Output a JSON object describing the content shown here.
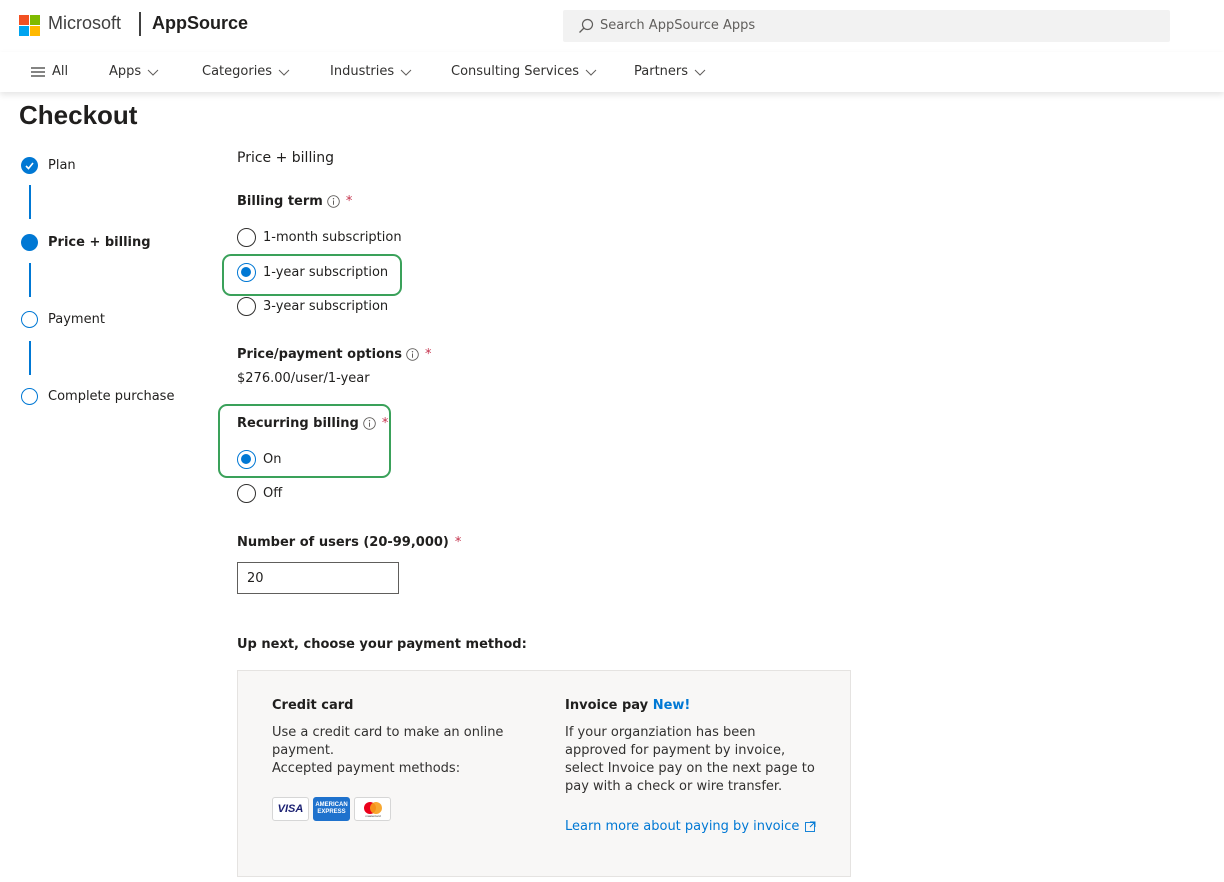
{
  "header": {
    "brand": "Microsoft",
    "app": "AppSource",
    "search_placeholder": "Search AppSource Apps",
    "logo_colors": [
      "#f25022",
      "#7fba00",
      "#00a4ef",
      "#ffb900"
    ]
  },
  "nav": {
    "all_label": "All",
    "items": [
      {
        "label": "Apps"
      },
      {
        "label": "Categories"
      },
      {
        "label": "Industries"
      },
      {
        "label": "Consulting Services"
      },
      {
        "label": "Partners"
      }
    ]
  },
  "page": {
    "title": "Checkout"
  },
  "steps": [
    {
      "label": "Plan",
      "state": "done"
    },
    {
      "label": "Price + billing",
      "state": "current"
    },
    {
      "label": "Payment",
      "state": "pending"
    },
    {
      "label": "Complete purchase",
      "state": "pending"
    }
  ],
  "form": {
    "section_title": "Price + billing",
    "billing_term": {
      "label": "Billing term",
      "required_mark": "*",
      "options": [
        "1-month subscription",
        "1-year subscription",
        "3-year subscription"
      ],
      "selected": "1-year subscription"
    },
    "price_options": {
      "label": "Price/payment options",
      "required_mark": "*",
      "value": "$276.00/user/1-year"
    },
    "recurring_billing": {
      "label": "Recurring billing",
      "required_mark": "*",
      "options": [
        "On",
        "Off"
      ],
      "selected": "On"
    },
    "users": {
      "label": "Number of users (20-99,000)",
      "required_mark": "*",
      "value": "20"
    }
  },
  "payment": {
    "heading": "Up next, choose your payment method:",
    "credit_card": {
      "title": "Credit card",
      "description": "Use a credit card to make an online payment.",
      "accepted": "Accepted payment methods:",
      "cards": [
        "VISA",
        "AMERICAN EXPRESS",
        "mastercard"
      ]
    },
    "invoice": {
      "title": "Invoice pay",
      "badge": "New!",
      "description": "If your organziation has been approved for payment by invoice, select Invoice pay on the next page to pay with a check or wire transfer.",
      "link": "Learn more about paying by invoice"
    }
  },
  "colors": {
    "accent": "#0078d4",
    "highlight": "#3aa15a",
    "required": "#c4314b"
  }
}
